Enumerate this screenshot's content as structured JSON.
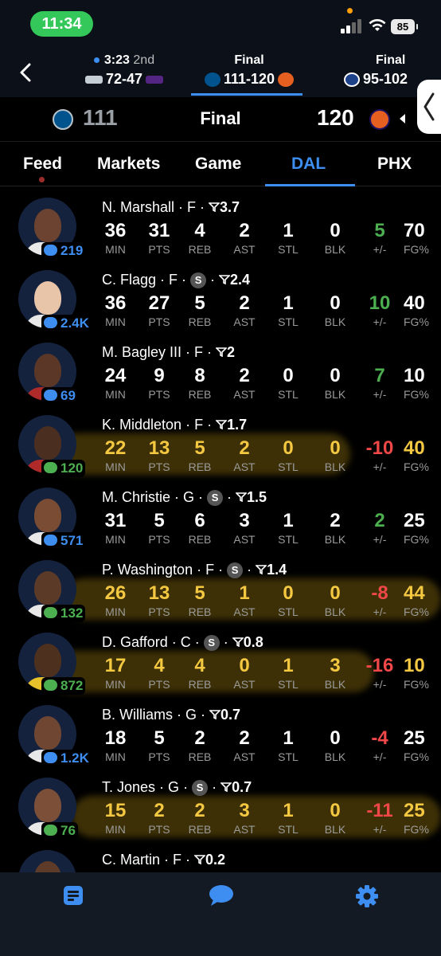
{
  "status_bar": {
    "time": "11:34",
    "battery": "85"
  },
  "games_strip": [
    {
      "status": "3:23",
      "quarter": "2nd",
      "score": "72-47",
      "live": true
    },
    {
      "status": "Final",
      "score": "111-120",
      "selected": true
    },
    {
      "status": "Final",
      "score": "95-102"
    }
  ],
  "score_header": {
    "home_score": "111",
    "status": "Final",
    "away_score": "120"
  },
  "tabs": [
    {
      "label": "Feed"
    },
    {
      "label": "Markets"
    },
    {
      "label": "Game"
    },
    {
      "label": "DAL",
      "active": true
    },
    {
      "label": "PHX"
    }
  ],
  "stat_labels": {
    "min": "MIN",
    "pts": "PTS",
    "reb": "REB",
    "ast": "AST",
    "stl": "STL",
    "blk": "BLK",
    "pm": "+/-",
    "fg": "FG%"
  },
  "players": [
    {
      "name": "N. Marshall",
      "pos": "F",
      "starter": false,
      "rating": "3.7",
      "comments": "219",
      "min": "36",
      "pts": "31",
      "reb": "4",
      "ast": "2",
      "stl": "1",
      "blk": "0",
      "pm": "5",
      "fg": "70",
      "highlight": false
    },
    {
      "name": "C. Flagg",
      "pos": "F",
      "starter": true,
      "rating": "2.4",
      "comments": "2.4K",
      "min": "36",
      "pts": "27",
      "reb": "5",
      "ast": "2",
      "stl": "1",
      "blk": "0",
      "pm": "10",
      "fg": "40",
      "highlight": false
    },
    {
      "name": "M. Bagley III",
      "pos": "F",
      "starter": false,
      "rating": "2",
      "comments": "69",
      "min": "24",
      "pts": "9",
      "reb": "8",
      "ast": "2",
      "stl": "0",
      "blk": "0",
      "pm": "7",
      "fg": "10",
      "highlight": false
    },
    {
      "name": "K. Middleton",
      "pos": "F",
      "starter": false,
      "rating": "1.7",
      "comments": "120",
      "min": "22",
      "pts": "13",
      "reb": "5",
      "ast": "2",
      "stl": "0",
      "blk": "0",
      "pm": "-10",
      "fg": "40",
      "highlight": true,
      "comments_green": true
    },
    {
      "name": "M. Christie",
      "pos": "G",
      "starter": true,
      "rating": "1.5",
      "comments": "571",
      "min": "31",
      "pts": "5",
      "reb": "6",
      "ast": "3",
      "stl": "1",
      "blk": "2",
      "pm": "2",
      "fg": "25",
      "highlight": false
    },
    {
      "name": "P. Washington",
      "pos": "F",
      "starter": true,
      "rating": "1.4",
      "comments": "132",
      "min": "26",
      "pts": "13",
      "reb": "5",
      "ast": "1",
      "stl": "0",
      "blk": "0",
      "pm": "-8",
      "fg": "44",
      "highlight": true,
      "comments_green": true
    },
    {
      "name": "D. Gafford",
      "pos": "C",
      "starter": true,
      "rating": "0.8",
      "comments": "872",
      "min": "17",
      "pts": "4",
      "reb": "4",
      "ast": "0",
      "stl": "1",
      "blk": "3",
      "pm": "-16",
      "fg": "10",
      "highlight": true,
      "comments_green": true
    },
    {
      "name": "B. Williams",
      "pos": "G",
      "starter": false,
      "rating": "0.7",
      "comments": "1.2K",
      "min": "18",
      "pts": "5",
      "reb": "2",
      "ast": "2",
      "stl": "1",
      "blk": "0",
      "pm": "-4",
      "fg": "25",
      "highlight": false
    },
    {
      "name": "T. Jones",
      "pos": "G",
      "starter": true,
      "rating": "0.7",
      "comments": "76",
      "min": "15",
      "pts": "2",
      "reb": "2",
      "ast": "3",
      "stl": "1",
      "blk": "0",
      "pm": "-11",
      "fg": "25",
      "highlight": true,
      "comments_green": true
    },
    {
      "name": "C. Martin",
      "pos": "F",
      "starter": false,
      "rating": "0.2",
      "comments": "",
      "min": "",
      "pts": "",
      "reb": "",
      "ast": "",
      "stl": "",
      "blk": "",
      "pm": "",
      "fg": "",
      "highlight": false
    }
  ],
  "colors": {
    "accent": "#3d8ef0",
    "positive": "#4caf50",
    "negative": "#f04848",
    "highlight": "#f5c842",
    "live_pill": "#34c759"
  },
  "icons": {
    "back": "chevron-left-icon",
    "boxscore": "document-icon",
    "chat": "chat-bubble-icon",
    "settings": "gear-icon"
  }
}
